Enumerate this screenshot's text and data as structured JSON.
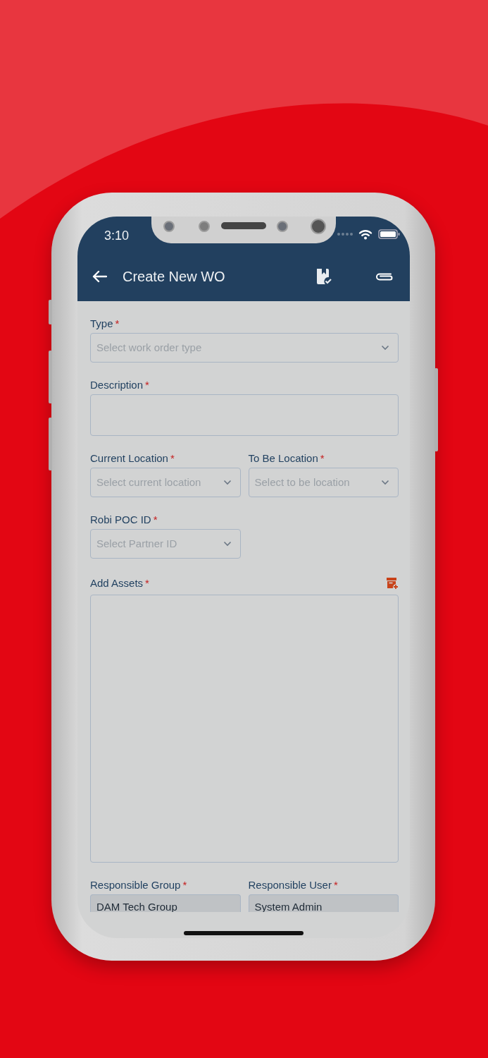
{
  "status_bar": {
    "time": "3:10"
  },
  "header": {
    "title": "Create New WO"
  },
  "form": {
    "rows": [
      {
        "fields": [
          {
            "label": "Type",
            "mark": "*",
            "kind": "select",
            "placeholder": "Select work order type",
            "wide": true
          }
        ]
      },
      {
        "fields": [
          {
            "label": "Description",
            "mark": "*",
            "kind": "textarea",
            "wide": true
          }
        ]
      },
      {
        "fields": [
          {
            "label": "Current Location",
            "mark": "*",
            "kind": "select",
            "placeholder": "Select current location",
            "wide": false
          },
          {
            "label": "To Be Location",
            "mark": "*",
            "kind": "select",
            "placeholder": "Select to be location",
            "wide": false
          }
        ]
      },
      {
        "fields": [
          {
            "label": "Robi POC ID",
            "mark": "*",
            "kind": "select",
            "placeholder": "Select Partner ID",
            "wide": false
          }
        ]
      },
      {
        "fields": [
          {
            "label": "Add Assets",
            "mark": "*",
            "kind": "assets",
            "wide": true
          }
        ]
      },
      {
        "fields": [
          {
            "label": "Responsible Group",
            "mark": "*",
            "kind": "text",
            "value": "DAM Tech Group",
            "wide": false
          },
          {
            "label": "Responsible User",
            "mark": "*",
            "kind": "text",
            "value": "System Admin",
            "wide": false
          }
        ]
      }
    ]
  }
}
